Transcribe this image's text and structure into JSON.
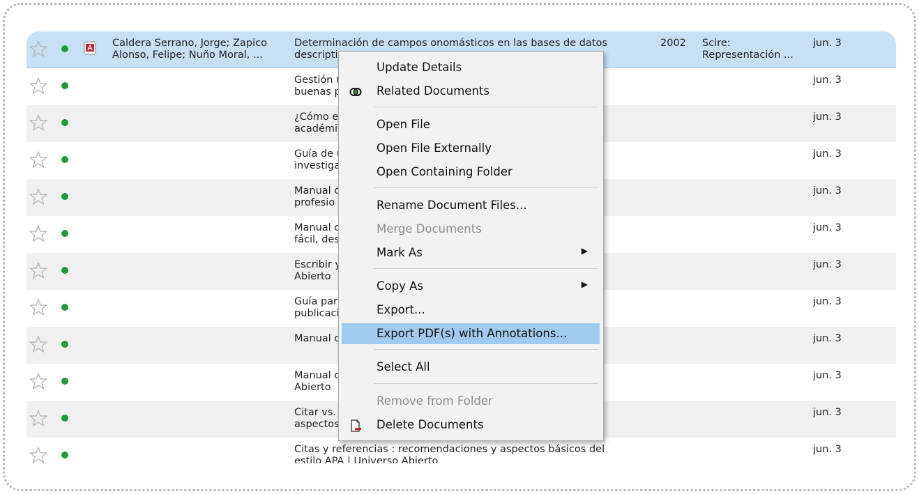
{
  "rows": [
    {
      "starred": false,
      "unread": true,
      "has_pdf": true,
      "authors": "Caldera Serrano, Jorge; Zapico\nAlonso, Felipe; Nuño Moral, ...",
      "title": "Determinación de campos onomásticos en las bases de datos\ndescripti",
      "year": "2002",
      "published_in": "Scire:\nRepresentación ...",
      "added": "jun. 3",
      "selected": true
    },
    {
      "starred": false,
      "unread": true,
      "has_pdf": false,
      "authors": "",
      "title": "Gestión (\nbuenas p",
      "year": "",
      "published_in": "",
      "added": "jun. 3"
    },
    {
      "starred": false,
      "unread": true,
      "has_pdf": false,
      "authors": "",
      "title": "¿Cómo e\nacadémi",
      "year": "",
      "published_in": "",
      "added": "jun. 3"
    },
    {
      "starred": false,
      "unread": true,
      "has_pdf": false,
      "authors": "",
      "title": "Guía de (\ninvestiga",
      "year": "",
      "published_in": "",
      "added": "jun. 3"
    },
    {
      "starred": false,
      "unread": true,
      "has_pdf": false,
      "authors": "",
      "title": "Manual c\nprofesio",
      "year": "",
      "published_in": "",
      "added": "jun. 3"
    },
    {
      "starred": false,
      "unread": true,
      "has_pdf": false,
      "authors": "",
      "title": "Manual c                                                                es\nfácil, des                                                                bi...",
      "year": "",
      "published_in": "",
      "added": "jun. 3"
    },
    {
      "starred": false,
      "unread": true,
      "has_pdf": false,
      "authors": "",
      "title": "Escribir y\nAbierto",
      "year": "",
      "published_in": "",
      "added": "jun. 3"
    },
    {
      "starred": false,
      "unread": true,
      "has_pdf": false,
      "authors": "",
      "title": "Guía par                                                                a\npublicaci",
      "year": "",
      "published_in": "",
      "added": "jun. 3"
    },
    {
      "starred": false,
      "unread": true,
      "has_pdf": false,
      "authors": "",
      "title": "Manual c",
      "year": "",
      "published_in": "",
      "added": "jun. 3"
    },
    {
      "starred": false,
      "unread": true,
      "has_pdf": false,
      "authors": "",
      "title": "Manual c\nAbierto",
      "year": "",
      "published_in": "",
      "added": "jun. 3"
    },
    {
      "starred": false,
      "unread": true,
      "has_pdf": false,
      "authors": "",
      "title": "Citar vs.\naspectos",
      "year": "",
      "published_in": "",
      "added": "jun. 3"
    },
    {
      "starred": false,
      "unread": true,
      "has_pdf": false,
      "authors": "",
      "title": "Citas y referencias : recomendaciones y aspectos básicos del\nestilo APA | Universo Abierto",
      "year": "",
      "published_in": "",
      "added": "jun. 3"
    }
  ],
  "context_menu": {
    "items": [
      {
        "label": "Update Details",
        "icon": "",
        "disabled": false
      },
      {
        "label": "Related Documents",
        "icon": "related-documents-icon",
        "disabled": false
      },
      {
        "label": "Open File",
        "icon": "",
        "disabled": false
      },
      {
        "label": "Open File Externally",
        "icon": "",
        "disabled": false
      },
      {
        "label": "Open Containing Folder",
        "icon": "",
        "disabled": false
      },
      {
        "label": "Rename Document Files...",
        "icon": "",
        "disabled": false
      },
      {
        "label": "Merge Documents",
        "icon": "",
        "disabled": true
      },
      {
        "label": "Mark As",
        "icon": "",
        "disabled": false,
        "submenu": true
      },
      {
        "label": "Copy As",
        "icon": "",
        "disabled": false,
        "submenu": true
      },
      {
        "label": "Export...",
        "icon": "",
        "disabled": false
      },
      {
        "label": "Export PDF(s) with Annotations...",
        "icon": "",
        "disabled": false,
        "highlighted": true
      },
      {
        "label": "Select All",
        "icon": "",
        "disabled": false
      },
      {
        "label": "Remove from Folder",
        "icon": "",
        "disabled": true
      },
      {
        "label": "Delete Documents",
        "icon": "delete-documents-icon",
        "disabled": false
      }
    ]
  },
  "colors": {
    "selected_row": "#c8e0f5",
    "menu_highlight": "#9fcbf0",
    "unread_dot": "#1f9a3a",
    "pdf_icon": "#d21f26"
  }
}
